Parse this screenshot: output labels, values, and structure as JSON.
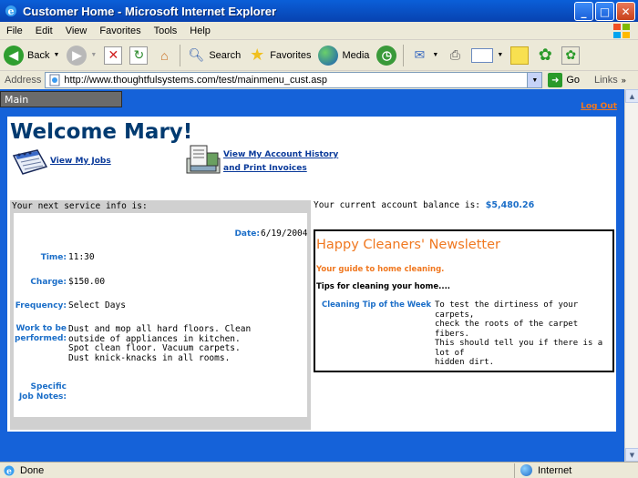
{
  "window": {
    "title": "Customer Home - Microsoft Internet Explorer",
    "buttons": {
      "minimize": "_",
      "maximize": "□",
      "close": "✕"
    }
  },
  "menu": [
    "File",
    "Edit",
    "View",
    "Favorites",
    "Tools",
    "Help"
  ],
  "toolbar": {
    "back": "Back",
    "search": "Search",
    "favorites": "Favorites",
    "media": "Media"
  },
  "address": {
    "label": "Address",
    "url": "http://www.thoughtfulsystems.com/test/mainmenu_cust.asp",
    "go": "Go",
    "links": "Links"
  },
  "page": {
    "nav_tab": "Main",
    "logout": "Log Out",
    "welcome": "Welcome Mary!",
    "view_jobs": "View My Jobs",
    "history_line1": "View My Account History",
    "history_line2": "and Print Invoices",
    "next_service_header": "Your next service info is:",
    "service": {
      "date_label": "Date:",
      "date": "6/19/2004",
      "time_label": "Time:",
      "time": "11:30",
      "charge_label": "Charge:",
      "charge": "$150.00",
      "frequency_label": "Frequency:",
      "frequency": "Select Days",
      "work_label_1": "Work to be",
      "work_label_2": "performed:",
      "work_lines": [
        "Dust and mop all hard floors. Clean",
        "outside of appliances in kitchen.",
        "Spot clean floor. Vacuum carpets.",
        "Dust knick-knacks in all rooms."
      ],
      "notes_label_1": "Specific",
      "notes_label_2": "Job Notes:"
    },
    "balance_label": "Your current account balance is:",
    "balance": "$5,480.26",
    "newsletter": {
      "title": "Happy Cleaners' Newsletter",
      "subtitle": "Your guide to home cleaning.",
      "tips_heading": "Tips for cleaning your home....",
      "tip_name": "Cleaning Tip of the Week",
      "tip_lines": [
        "To test the dirtiness of your carpets,",
        "check the roots of the carpet fibers.",
        "This should tell you if there is a lot of",
        "hidden dirt."
      ]
    }
  },
  "status": {
    "text": "Done",
    "zone": "Internet"
  }
}
